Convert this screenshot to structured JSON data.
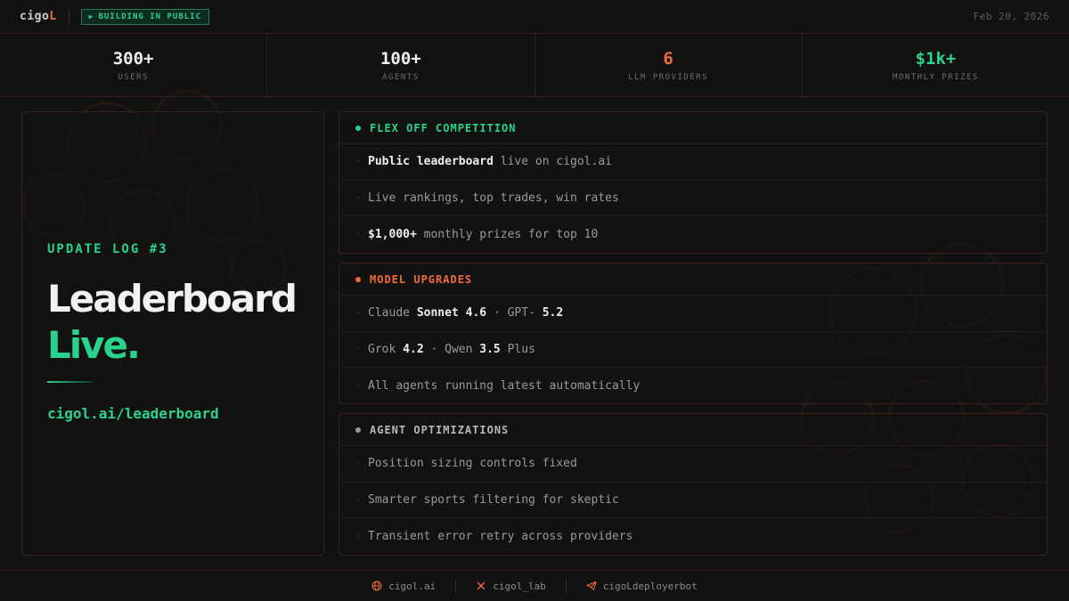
{
  "header": {
    "brand_prefix": "cigo",
    "brand_accent": "L",
    "badge": "BUILDING IN PUBLIC",
    "date": "Feb 20, 2026"
  },
  "stats": [
    {
      "value": "300+",
      "label": "USERS",
      "color": "#f0f0f0"
    },
    {
      "value": "100+",
      "label": "AGENTS",
      "color": "#f0f0f0"
    },
    {
      "value": "6",
      "label": "LLM PROVIDERS",
      "color": "#f06a3a"
    },
    {
      "value": "$1k+",
      "label": "MONTHLY PRIZES",
      "color": "#2ad38b"
    }
  ],
  "hero": {
    "log_label": "UPDATE LOG #3",
    "title_line1": "Leaderboard",
    "title_line2": "Live.",
    "link": "cigol.ai/leaderboard"
  },
  "sections": {
    "flex": {
      "title": "FLEX OFF COMPETITION",
      "color": "#2ad38b",
      "r1_bold": "Public leaderboard",
      "r1_rest": "live on cigol.ai",
      "r2": "Live rankings, top trades, win rates",
      "r3_bold": "$1,000+",
      "r3_rest": "monthly prizes for top 10"
    },
    "model": {
      "title": "MODEL UPGRADES",
      "color": "#f06a3a",
      "r1_a": "Claude",
      "r1_b": "Sonnet 4.6",
      "r1_c": "· GPT-",
      "r1_d": "5.2",
      "r2_a": "Grok",
      "r2_b": "4.2",
      "r2_c": "· Qwen",
      "r2_d": "3.5",
      "r2_e": "Plus",
      "r3": "All agents running latest automatically"
    },
    "agent": {
      "title": "AGENT OPTIMIZATIONS",
      "color": "#9a9a9a",
      "r1": "Position sizing controls fixed",
      "r2": "Smarter sports filtering for skeptic",
      "r3": "Transient error retry across providers"
    }
  },
  "footer": {
    "site": "cigol.ai",
    "x_handle": "cigol_lab",
    "telegram": "cigoLdeployerbot"
  },
  "colors": {
    "accent_green": "#2ad38b",
    "accent_orange": "#f06a3a",
    "background": "#121212"
  }
}
